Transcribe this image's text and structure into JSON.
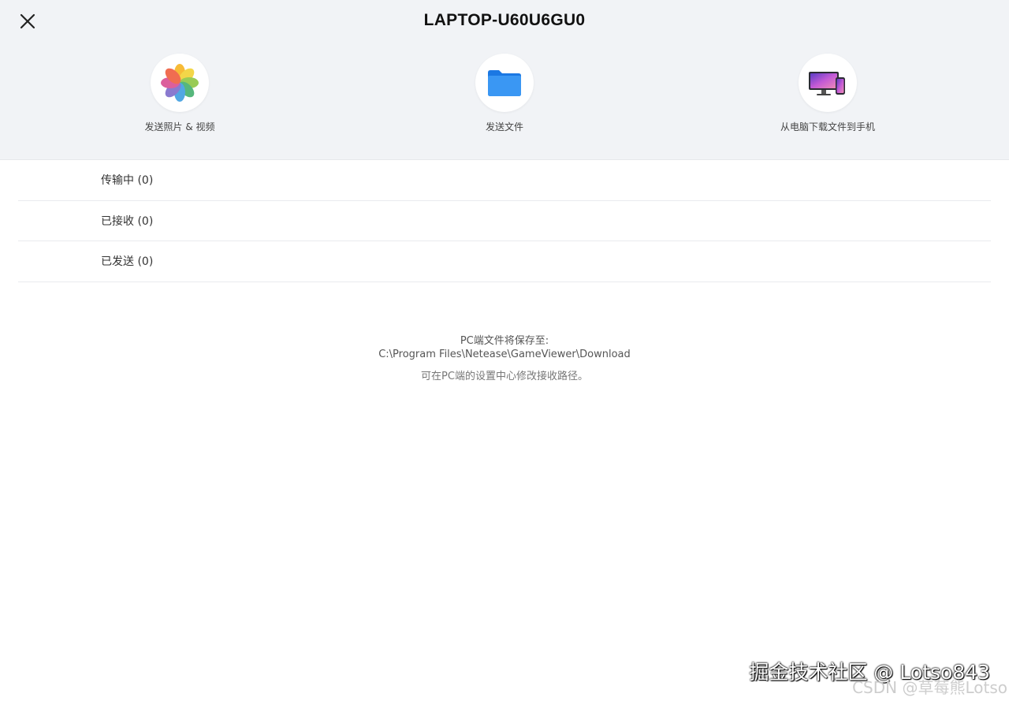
{
  "header": {
    "title": "LAPTOP-U60U6GU0",
    "actions": [
      {
        "label": "发送照片 & 视频",
        "icon": "photos-icon"
      },
      {
        "label": "发送文件",
        "icon": "folder-icon"
      },
      {
        "label": "从电脑下载文件到手机",
        "icon": "devices-icon"
      }
    ]
  },
  "list": {
    "items": [
      {
        "label": "传输中 (0)"
      },
      {
        "label": "已接收 (0)"
      },
      {
        "label": "已发送 (0)"
      }
    ]
  },
  "info": {
    "save_to_label": "PC端文件将保存至:",
    "save_path": "C:\\Program Files\\Netease\\GameViewer\\Download",
    "hint": "可在PC端的设置中心修改接收路径。"
  },
  "watermark": {
    "line1": "掘金技术社区 @ Lotso843",
    "line2": "CSDN @草莓熊Lotso"
  },
  "colors": {
    "header_bg": "#f1f3f6",
    "folder_blue": "#2f8cf0"
  }
}
